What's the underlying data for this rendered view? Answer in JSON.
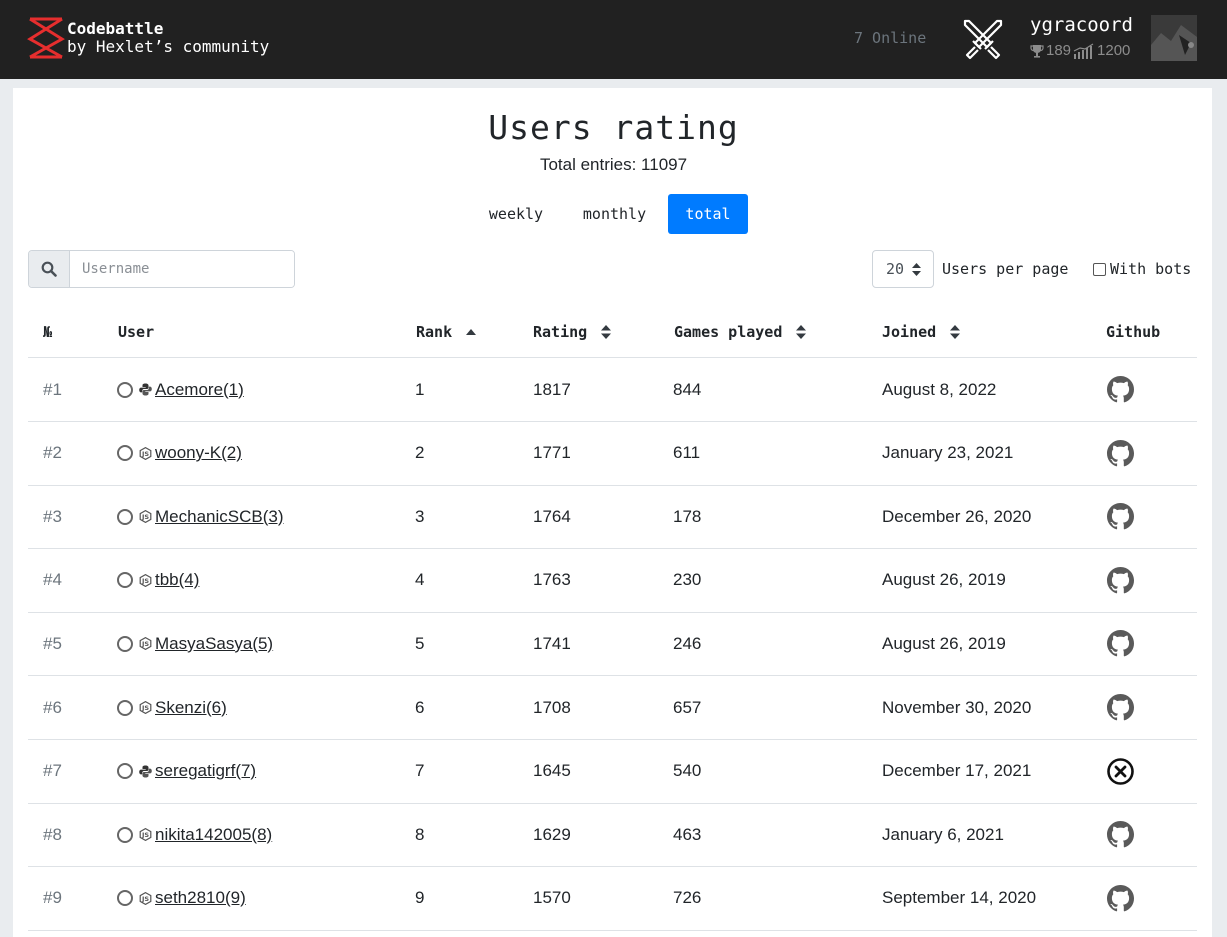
{
  "header": {
    "brand_line1": "Codebattle",
    "brand_line2": "by Hexlet’s community",
    "online": "7 Online",
    "user": {
      "name": "ygracoord",
      "trophies": "189",
      "rating": "1200"
    }
  },
  "page": {
    "title": "Users rating",
    "total": "Total entries: 11097"
  },
  "tabs": [
    {
      "label": "weekly",
      "active": false
    },
    {
      "label": "monthly",
      "active": false
    },
    {
      "label": "total",
      "active": true
    }
  ],
  "search": {
    "placeholder": "Username"
  },
  "controls": {
    "per_page": "20",
    "per_page_label": "Users per page",
    "with_bots": "With bots"
  },
  "columns": {
    "num": "№",
    "user": "User",
    "rank": "Rank",
    "rating": "Rating",
    "games": "Games played",
    "joined": "Joined",
    "github": "Github"
  },
  "rows": [
    {
      "num": "#1",
      "lang": "python",
      "user": "Acemore(1)",
      "rank": "1",
      "rating": "1817",
      "games": "844",
      "joined": "August 8, 2022",
      "github": "github"
    },
    {
      "num": "#2",
      "lang": "js",
      "user": "woony-K(2)",
      "rank": "2",
      "rating": "1771",
      "games": "611",
      "joined": "January 23, 2021",
      "github": "github"
    },
    {
      "num": "#3",
      "lang": "js",
      "user": "MechanicSCB(3)",
      "rank": "3",
      "rating": "1764",
      "games": "178",
      "joined": "December 26, 2020",
      "github": "github"
    },
    {
      "num": "#4",
      "lang": "js",
      "user": "tbb(4)",
      "rank": "4",
      "rating": "1763",
      "games": "230",
      "joined": "August 26, 2019",
      "github": "github"
    },
    {
      "num": "#5",
      "lang": "js",
      "user": "MasyaSasya(5)",
      "rank": "5",
      "rating": "1741",
      "games": "246",
      "joined": "August 26, 2019",
      "github": "github"
    },
    {
      "num": "#6",
      "lang": "js",
      "user": "Skenzi(6)",
      "rank": "6",
      "rating": "1708",
      "games": "657",
      "joined": "November 30, 2020",
      "github": "github"
    },
    {
      "num": "#7",
      "lang": "python",
      "user": "seregatigrf(7)",
      "rank": "7",
      "rating": "1645",
      "games": "540",
      "joined": "December 17, 2021",
      "github": "none"
    },
    {
      "num": "#8",
      "lang": "js",
      "user": "nikita142005(8)",
      "rank": "8",
      "rating": "1629",
      "games": "463",
      "joined": "January 6, 2021",
      "github": "github"
    },
    {
      "num": "#9",
      "lang": "js",
      "user": "seth2810(9)",
      "rank": "9",
      "rating": "1570",
      "games": "726",
      "joined": "September 14, 2020",
      "github": "github"
    }
  ],
  "colors": {
    "accent": "#007bff",
    "navbar": "#212121",
    "logo": "#e62e2e"
  }
}
